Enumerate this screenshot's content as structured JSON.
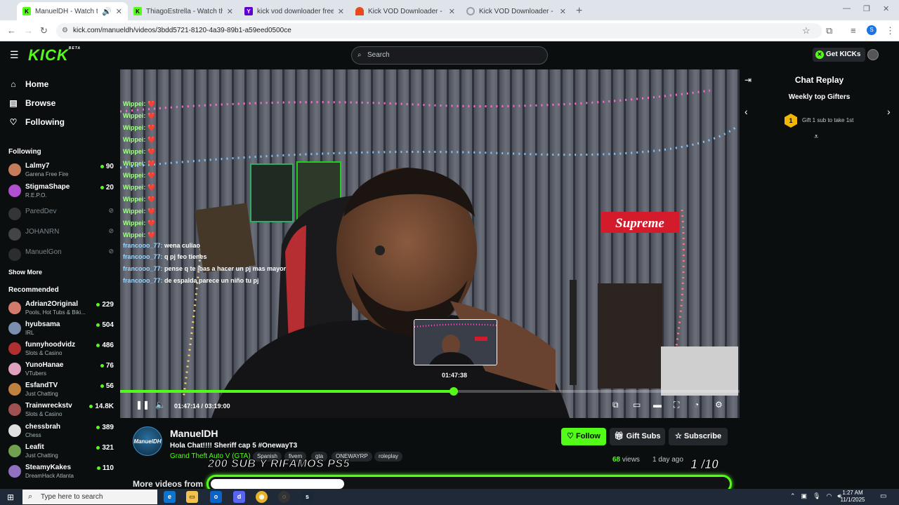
{
  "browser": {
    "tabs": [
      {
        "title": "ManuelDH - Watch the VO",
        "active": true,
        "favicon_color": "#53fc18",
        "favicon_letter": "K"
      },
      {
        "title": "ThiagoEstrella - Watch the VOD",
        "active": false,
        "favicon_color": "#53fc18",
        "favicon_letter": "K"
      },
      {
        "title": "kick vod downloader free mp3",
        "active": false,
        "favicon_color": "#6001d2",
        "favicon_letter": "Y"
      },
      {
        "title": "Kick VOD Downloader - Chrom",
        "active": false,
        "favicon_color": "#e8491d",
        "favicon_letter": ""
      },
      {
        "title": "Kick VOD Downloader - Stream",
        "active": false,
        "favicon_color": "#9aa0a6",
        "favicon_letter": ""
      }
    ],
    "url": "kick.com/manueldh/videos/3bdd5721-8120-4a39-89b1-a59eed0500ce",
    "profile_letter": "S"
  },
  "kick": {
    "logo": "KICK",
    "logo_badge": "BETA",
    "search_placeholder": "Search",
    "get_kicks": "Get KICKs"
  },
  "sidebar": {
    "nav": [
      {
        "label": "Home",
        "icon": "home-icon"
      },
      {
        "label": "Browse",
        "icon": "browse-icon"
      },
      {
        "label": "Following",
        "icon": "heart-icon"
      }
    ],
    "following_title": "Following",
    "following": [
      {
        "name": "Lalmy7",
        "category": "Garena Free Fire",
        "viewers": "90",
        "live": true,
        "color": "#c47d5a"
      },
      {
        "name": "StigmaShape",
        "category": "R.E.P.O.",
        "viewers": "20",
        "live": true,
        "color": "#b04fd0"
      },
      {
        "name": "ParedDev",
        "category": "",
        "viewers": "",
        "live": false,
        "color": "#666666"
      },
      {
        "name": "JOHANRN",
        "category": "",
        "viewers": "",
        "live": false,
        "color": "#888888"
      },
      {
        "name": "ManuelGon",
        "category": "",
        "viewers": "",
        "live": false,
        "color": "#555555"
      }
    ],
    "show_more": "Show More",
    "recommended_title": "Recommended",
    "recommended": [
      {
        "name": "Adrian2Original",
        "category": "Pools, Hot Tubs & Biki...",
        "viewers": "229",
        "color": "#d47a6a"
      },
      {
        "name": "hyubsama",
        "category": "IRL",
        "viewers": "504",
        "color": "#7a8fb0"
      },
      {
        "name": "funnyhoodvidz",
        "category": "Slots & Casino",
        "viewers": "486",
        "color": "#b03030"
      },
      {
        "name": "YunoHanae",
        "category": "VTubers",
        "viewers": "76",
        "color": "#e0a0c0"
      },
      {
        "name": "EsfandTV",
        "category": "Just Chatting",
        "viewers": "56",
        "color": "#c08040"
      },
      {
        "name": "Trainwreckstv",
        "category": "Slots & Casino",
        "viewers": "14.8K",
        "color": "#a05050"
      },
      {
        "name": "chessbrah",
        "category": "Chess",
        "viewers": "389",
        "color": "#e0e0e0"
      },
      {
        "name": "Leafit",
        "category": "Just Chatting",
        "viewers": "321",
        "color": "#70a050"
      },
      {
        "name": "SteamyKakes",
        "category": "DreamHack Atlanta",
        "viewers": "110",
        "color": "#9070c0"
      }
    ]
  },
  "video": {
    "overlay_chat": [
      {
        "user": "Wippei:",
        "msg": "❤️"
      },
      {
        "user": "Wippei:",
        "msg": "❤️"
      },
      {
        "user": "Wippei:",
        "msg": "❤️"
      },
      {
        "user": "Wippei:",
        "msg": "❤️"
      },
      {
        "user": "Wippei:",
        "msg": "❤️"
      },
      {
        "user": "Wippei:",
        "msg": "❤️"
      },
      {
        "user": "Wippei:",
        "msg": "❤️"
      },
      {
        "user": "Wippei:",
        "msg": "❤️"
      },
      {
        "user": "Wippei:",
        "msg": "❤️"
      },
      {
        "user": "Wippei:",
        "msg": "❤️"
      },
      {
        "user": "Wippei:",
        "msg": "❤️"
      },
      {
        "user": "Wippei:",
        "msg": "❤️"
      },
      {
        "user": "francooo_77:",
        "msg": "wena culiao"
      },
      {
        "user": "francooo_77:",
        "msg": "q pj feo tienes"
      },
      {
        "user": "francooo_77:",
        "msg": "pense q te ibas a hacer un pj mas mayor"
      },
      {
        "user": "francooo_77:",
        "msg": "de espalda parece un niño tu pj"
      }
    ],
    "scene_sign": "Supreme",
    "hover_time": "01:47:38",
    "current_time": "01:47:14",
    "duration": "03:19:00",
    "progress": 0.538
  },
  "info": {
    "channel_name": "ManuelDH",
    "avatar_text": "ManuelDH",
    "title": "Hola Chat!!!! Sheriff cap 5 #OnewayT3",
    "category": "Grand Theft Auto V (GTA)",
    "tags": [
      "Spanish",
      "fivem",
      "gta",
      "ONEWAYRP",
      "roleplay"
    ],
    "follow": "Follow",
    "gift_subs": "Gift Subs",
    "subscribe": "Subscribe",
    "views_count": "68",
    "views_label": "views",
    "ago": "1 day ago",
    "more_videos": "More videos from",
    "overlay_banner": "200 SUB Y RIFAMOS PS5",
    "overlay_count": "1 /10",
    "goal_fraction": 0.1
  },
  "chat": {
    "title": "Chat Replay",
    "gifters_title": "Weekly top Gifters",
    "gift_prompt": "Gift 1 sub to take 1st",
    "rank": "1"
  },
  "taskbar": {
    "search_placeholder": "Type here to search",
    "time": "1:27 AM",
    "date": "11/1/2025"
  },
  "colors": {
    "kick_green": "#53fc18",
    "background": "#0b0e0f",
    "button_dark": "#24272c"
  }
}
